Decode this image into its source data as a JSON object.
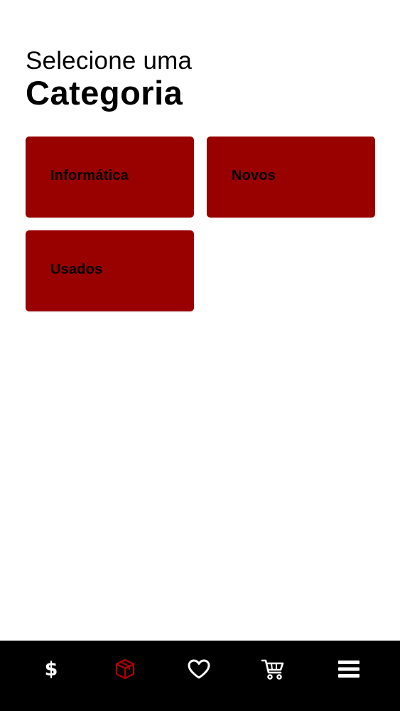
{
  "header": {
    "subtitle": "Selecione uma",
    "title": "Categoria"
  },
  "categories": [
    {
      "label": "Informática"
    },
    {
      "label": "Novos"
    },
    {
      "label": "Usados"
    }
  ],
  "colors": {
    "card_bg": "#990000",
    "nav_bg": "#000000",
    "active_icon": "#b30000",
    "inactive_icon": "#ffffff"
  },
  "bottom_nav": {
    "items": [
      {
        "icon": "dollar-icon",
        "glyph": "$",
        "active": false
      },
      {
        "icon": "box-icon",
        "active": true
      },
      {
        "icon": "heart-icon",
        "active": false
      },
      {
        "icon": "cart-icon",
        "active": false
      },
      {
        "icon": "menu-icon",
        "active": false
      }
    ]
  }
}
